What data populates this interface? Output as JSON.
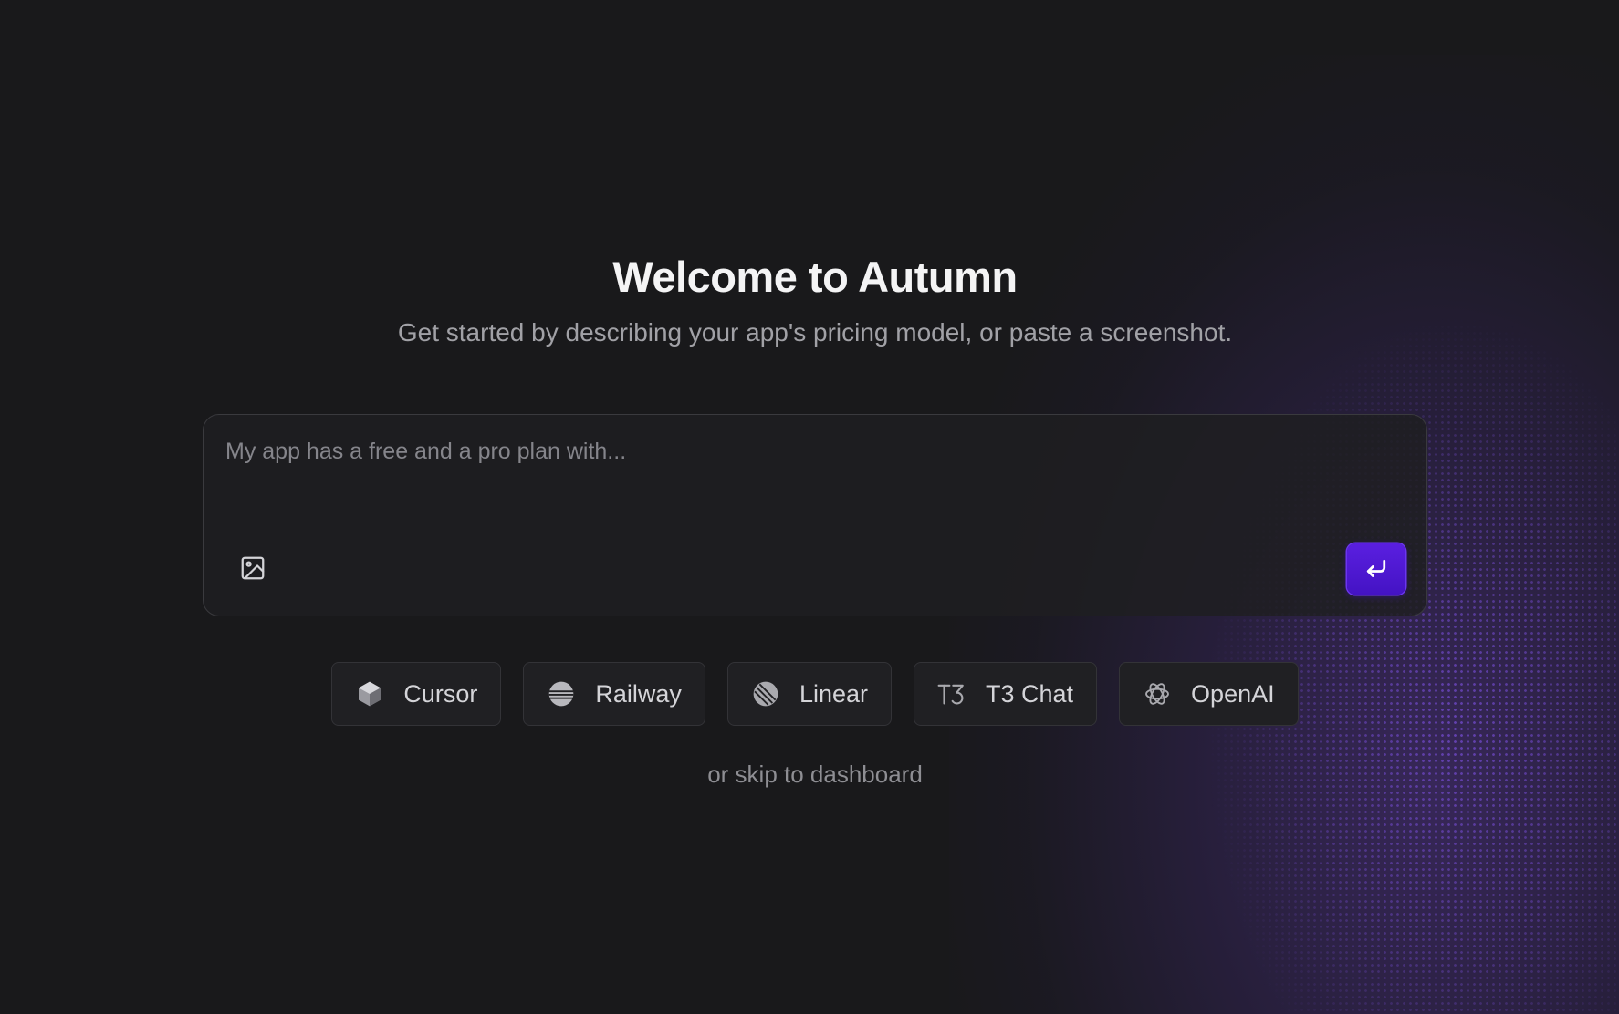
{
  "header": {
    "title": "Welcome to Autumn",
    "subtitle": "Get started by describing your app's pricing model, or paste a screenshot."
  },
  "prompt": {
    "placeholder": "My app has a free and a pro plan with...",
    "value": "",
    "image_icon": "image-icon",
    "submit_icon": "enter-arrow-icon"
  },
  "examples": [
    {
      "label": "Cursor",
      "icon": "cursor-logo-icon"
    },
    {
      "label": "Railway",
      "icon": "railway-logo-icon"
    },
    {
      "label": "Linear",
      "icon": "linear-logo-icon"
    },
    {
      "label": "T3 Chat",
      "icon": "t3-logo-icon"
    },
    {
      "label": "OpenAI",
      "icon": "openai-logo-icon"
    }
  ],
  "skip_label": "or skip to dashboard",
  "colors": {
    "background": "#19191b",
    "accent": "#4f18d6",
    "text_primary": "#f4f4f5",
    "text_secondary": "#a1a1a6"
  }
}
